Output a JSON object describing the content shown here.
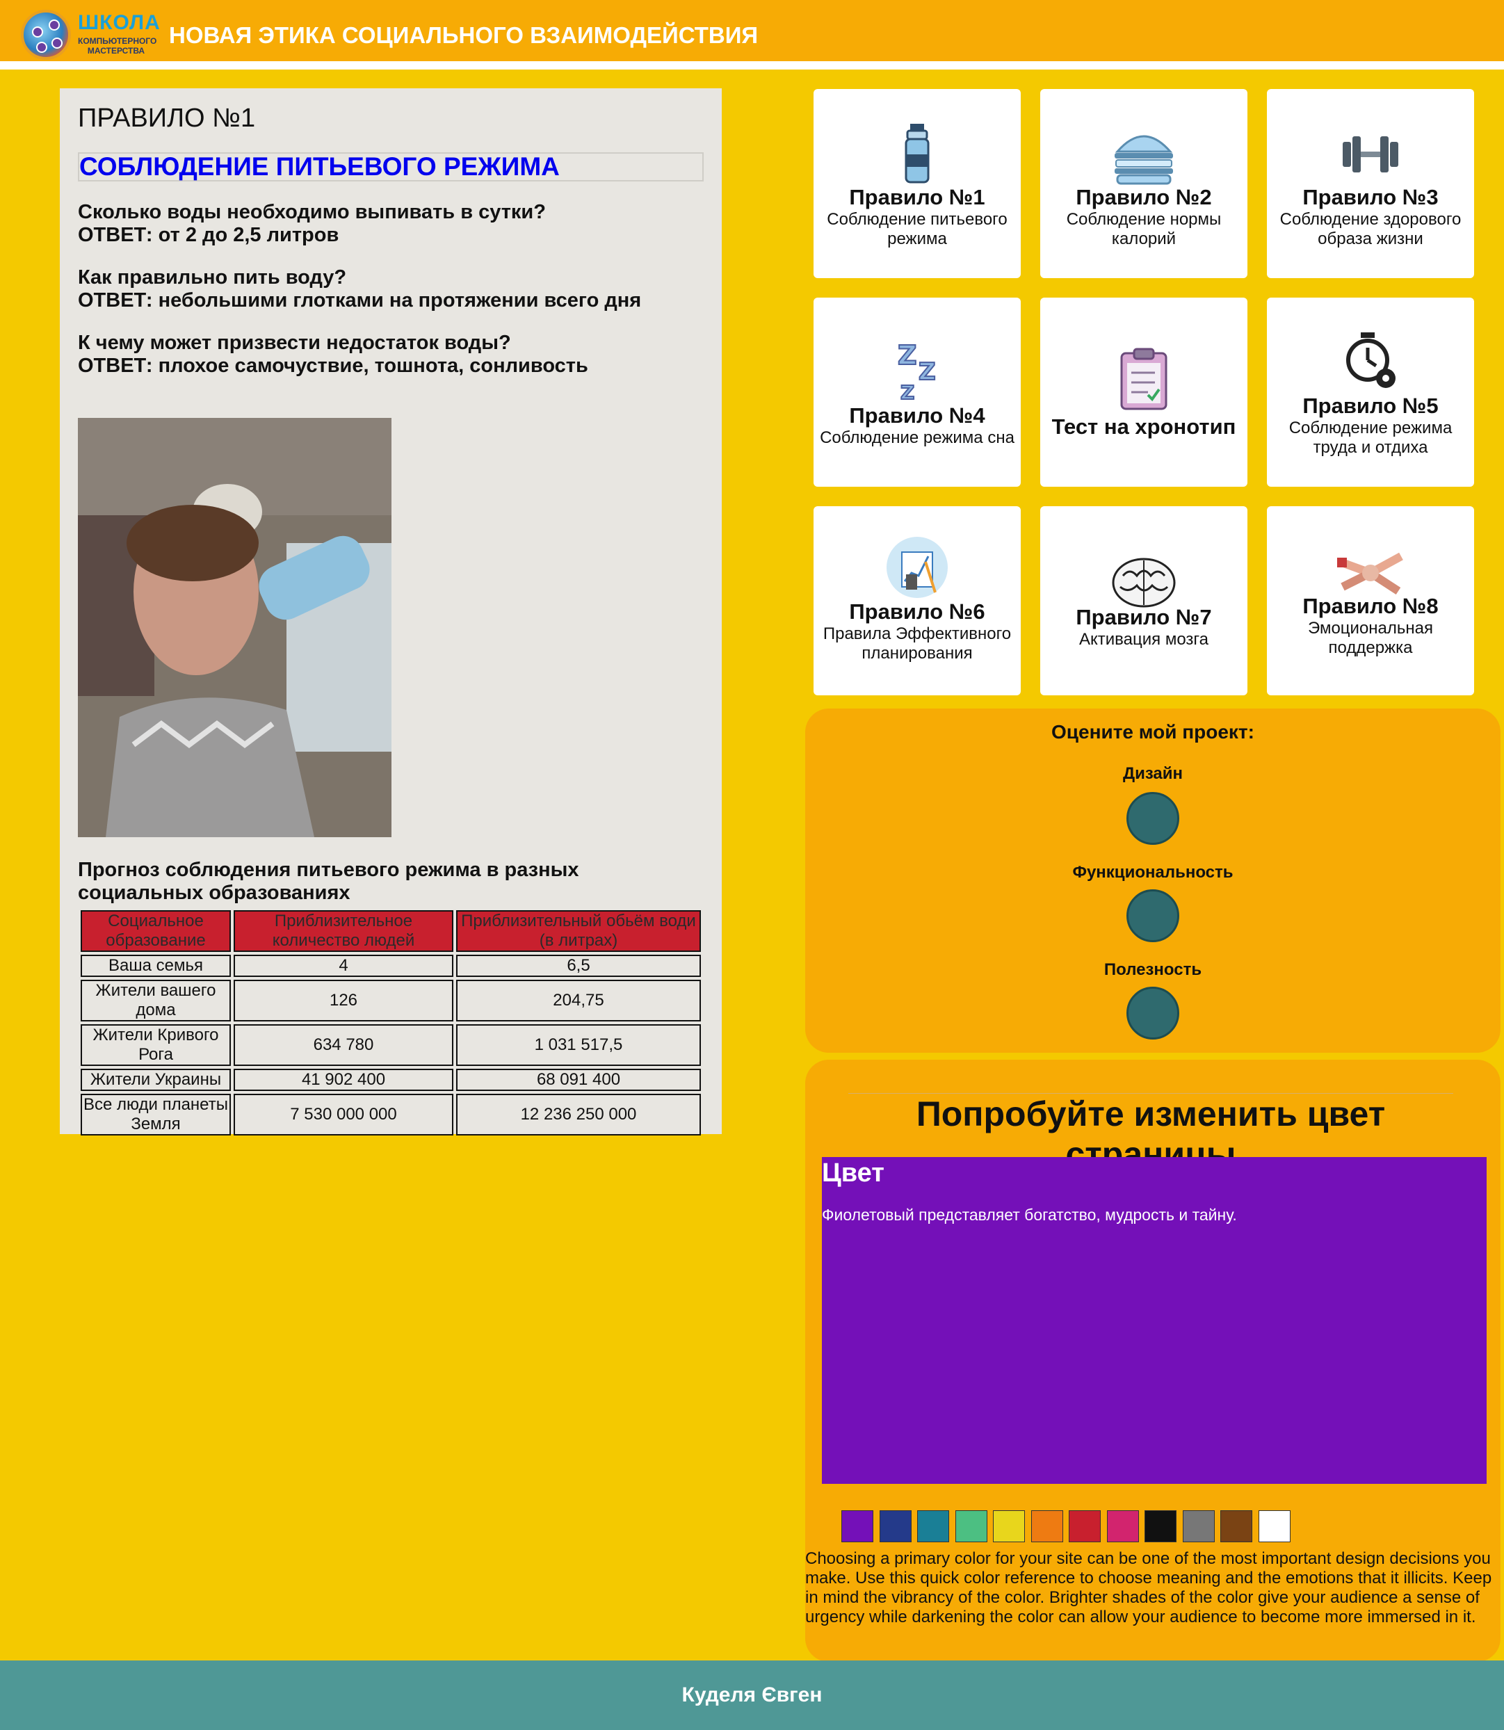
{
  "header": {
    "logo_title": "ШКОЛА",
    "logo_subtitle": "КОМПЬЮТЕРНОГО МАСТЕРСТВА",
    "site_title": "НОВАЯ ЭТИКА СОЦИАЛЬНОГО ВЗАИМОДЕЙСТВИЯ"
  },
  "article": {
    "rule_title": "ПРАВИЛО №1",
    "rule_subtitle": "СОБЛЮДЕНИЕ ПИТЬЕВОГО РЕЖИМА",
    "qa": [
      {
        "q": "Сколько воды необходимо выпивать в сутки?",
        "a": "ОТВЕТ: от 2 до 2,5 литров"
      },
      {
        "q": "Как правильно пить воду?",
        "a": "ОТВЕТ: небольшими глотками на протяжении всего дня"
      },
      {
        "q": "К чему может призвести недостаток воды?",
        "a": "ОТВЕТ: плохое самочуствие, тошнота, сонливость"
      }
    ],
    "forecast_title": "Прогноз соблюдения питьевого режима в разных социальных образованиях",
    "table": {
      "headers": [
        "Социальное образование",
        "Приблизительное количество людей",
        "Приблизительный обьём води (в литрах)"
      ],
      "rows": [
        [
          "Ваша семья",
          "4",
          "6,5"
        ],
        [
          "Жители вашего дома",
          "126",
          "204,75"
        ],
        [
          "Жители Кривого Рога",
          "634 780",
          "1 031 517,5"
        ],
        [
          "Жители Украины",
          "41 902 400",
          "68 091 400"
        ],
        [
          "Все люди планеты Земля",
          "7 530 000 000",
          "12 236 250 000"
        ]
      ]
    }
  },
  "tiles": [
    {
      "icon": "water-bottle-icon",
      "title": "Правило №1",
      "desc": "Соблюдение питьевого режима"
    },
    {
      "icon": "burger-icon",
      "title": "Правило №2",
      "desc": "Соблюдение нормы калорий"
    },
    {
      "icon": "dumbbell-icon",
      "title": "Правило №3",
      "desc": "Соблюдение здорового образа жизни"
    },
    {
      "icon": "sleep-zzz-icon",
      "title": "Правило №4",
      "desc": "Соблюдение режима сна"
    },
    {
      "icon": "clipboard-icon",
      "title": "Тест на хронотип",
      "desc": ""
    },
    {
      "icon": "stopwatch-gear-icon",
      "title": "Правило №5",
      "desc": "Соблюдение режима труда и отдиха"
    },
    {
      "icon": "planning-chart-icon",
      "title": "Правило №6",
      "desc": "Правила Эффективного планирования"
    },
    {
      "icon": "brain-icon",
      "title": "Правило №7",
      "desc": "Активация мозга"
    },
    {
      "icon": "hands-together-icon",
      "title": "Правило №8",
      "desc": "Эмоциональная поддержка"
    }
  ],
  "rating": {
    "title": "Оцените мой проект:",
    "items": [
      {
        "label": "Дизайн",
        "button": ""
      },
      {
        "label": "Функциональность",
        "button": ""
      },
      {
        "label": "Полезность",
        "button": ""
      }
    ]
  },
  "color_section": {
    "heading": "Попробуйте изменить цвет страницы",
    "panel_title": "Цвет",
    "panel_desc": "Фиолетовый представляет богатство, мудрость и тайну.",
    "selected_color": "#7410b8",
    "swatches": [
      "#7410b8",
      "#243a8a",
      "#1a7f96",
      "#4cbf82",
      "#e8d61c",
      "#ee7b12",
      "#c8202e",
      "#d2246e",
      "#111111",
      "#777777",
      "#7a4314",
      "#ffffff"
    ],
    "note": "Choosing a primary color for your site can be one of the most important design decisions you make. Use this quick color reference to choose meaning and the emotions that it illicits. Keep in mind the vibrancy of the color. Brighter shades of the color give your audience a sense of urgency while darkening the color can allow your audience to become more immersed in it."
  },
  "footer": {
    "author": "Куделя Євген"
  },
  "colors": {
    "page_bg": "#f4c900",
    "header_bg": "#f7ab05",
    "footer_bg": "#4f9896",
    "accent_blue": "#0000ee",
    "table_header": "#c8202e"
  }
}
